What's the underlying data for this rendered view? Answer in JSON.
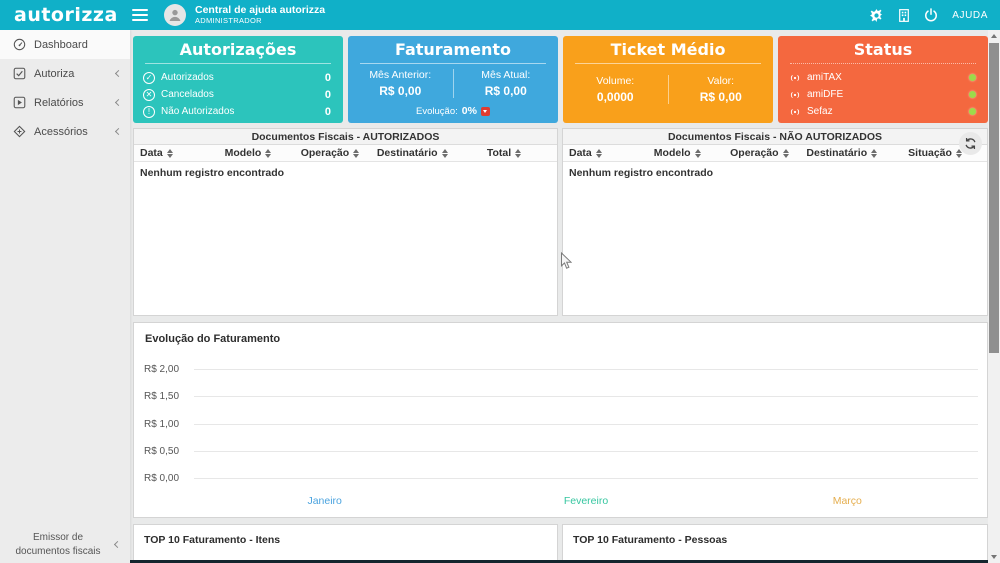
{
  "header": {
    "logo": "autorizza",
    "help_center_title": "Central de ajuda autorizza",
    "help_center_subtitle": "ADMINISTRADOR",
    "ajuda_label": "AJUDA",
    "bar_color": "#10b0c8"
  },
  "icons": {
    "check": "✓",
    "cancel": "✕",
    "exclamation": "!"
  },
  "sidebar": {
    "items": [
      {
        "label": "Dashboard",
        "icon": "gauge-icon",
        "active": true
      },
      {
        "label": "Autoriza",
        "icon": "checkbox-icon",
        "active": false
      },
      {
        "label": "Relatórios",
        "icon": "report-icon",
        "active": false
      },
      {
        "label": "Acessórios",
        "icon": "diamond-icon",
        "active": false
      }
    ],
    "footer_label": "Emissor de documentos fiscais"
  },
  "cards": {
    "autorizacoes": {
      "title": "Autorizações",
      "color": "#2cc4bc",
      "rows": [
        {
          "label": "Autorizados",
          "value": "0"
        },
        {
          "label": "Cancelados",
          "value": "0"
        },
        {
          "label": "Não Autorizados",
          "value": "0"
        }
      ]
    },
    "faturamento": {
      "title": "Faturamento",
      "color": "#3fa8dd",
      "previous_label": "Mês Anterior:",
      "previous_value": "R$ 0,00",
      "current_label": "Mês Atual:",
      "current_value": "R$ 0,00",
      "evolution_label": "Evolução:",
      "evolution_value": "0%"
    },
    "ticket_medio": {
      "title": "Ticket Médio",
      "color": "#f9a01b",
      "volume_label": "Volume:",
      "volume_value": "0,0000",
      "valor_label": "Valor:",
      "valor_value": "R$ 0,00"
    },
    "status": {
      "title": "Status",
      "color": "#f4683f",
      "online_color": "#9ddb4a",
      "services": [
        {
          "name": "amiTAX"
        },
        {
          "name": "amiDFE"
        },
        {
          "name": "Sefaz"
        }
      ]
    }
  },
  "tables": {
    "authorized": {
      "title": "Documentos Fiscais - AUTORIZADOS",
      "columns": [
        "Data",
        "Modelo",
        "Operação",
        "Destinatário",
        "Total"
      ],
      "empty_message": "Nenhum registro encontrado"
    },
    "not_authorized": {
      "title": "Documentos Fiscais - NÃO AUTORIZADOS",
      "columns": [
        "Data",
        "Modelo",
        "Operação",
        "Destinatário",
        "Situação"
      ],
      "empty_message": "Nenhum registro encontrado"
    }
  },
  "chart_data": {
    "type": "line",
    "title": "Evolução do Faturamento",
    "x": [
      "Janeiro",
      "Fevereiro",
      "Março"
    ],
    "x_label_colors": [
      "#4aa3df",
      "#36c6a0",
      "#e5ae4e"
    ],
    "y_ticks": [
      "R$ 2,00",
      "R$ 1,50",
      "R$ 1,00",
      "R$ 0,50",
      "R$ 0,00"
    ],
    "ylim": [
      0,
      2
    ],
    "series": [],
    "grid": true,
    "legend": "none"
  },
  "bottom_panels": [
    {
      "title": "TOP 10 Faturamento - Itens"
    },
    {
      "title": "TOP 10 Faturamento - Pessoas"
    }
  ]
}
